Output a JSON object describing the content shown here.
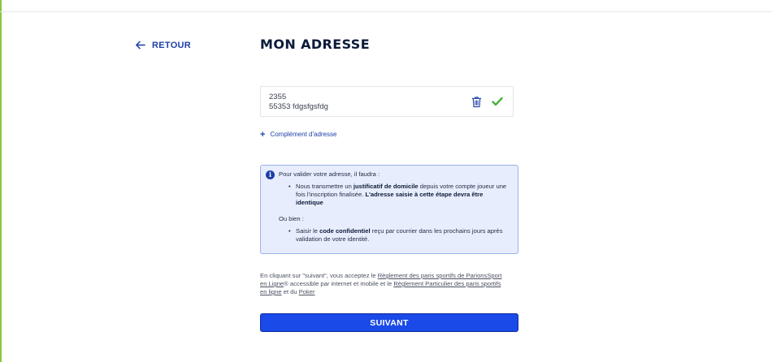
{
  "header": {
    "back_label": "RETOUR",
    "title": "MON ADRESSE"
  },
  "address": {
    "line1": "2355",
    "line2": "55353 fdgsfgsfdg"
  },
  "complement": {
    "label": "Complément d'adresse"
  },
  "info": {
    "intro": "Pour valider votre adresse, il faudra :",
    "item1": {
      "pre": "Nous transmettre un ",
      "bold1": "justificatif de domicile",
      "mid": " depuis votre compte joueur une fois l'inscription finalisée. ",
      "bold2": "L'adresse saisie à cette étape devra être identique"
    },
    "or_label": "Ou bien :",
    "item2": {
      "pre": "Saisir le ",
      "bold": "code confidentiel",
      "post": " reçu par courrier dans les prochains jours après validation de votre identité."
    }
  },
  "legal": {
    "t1": "En cliquant sur \"suivant\", vous acceptez le ",
    "link1": "Règlement des paris sportifs de ParionsSport en Ligne",
    "t2": "® accessible par internet et mobile et le ",
    "link2": "Règlement Particulier des paris sportifs en ligne",
    "t3": " et du ",
    "link3": "Poker"
  },
  "actions": {
    "next_label": "SUIVANT"
  },
  "colors": {
    "brand_blue": "#1a4ae8",
    "link_blue": "#1d3fa8",
    "success_green": "#4caf3e",
    "info_bg": "#e7edfc"
  },
  "icons": {
    "back": "arrow-left-icon",
    "delete": "trash-icon",
    "valid": "check-icon",
    "add": "plus-icon",
    "info": "info-icon"
  }
}
